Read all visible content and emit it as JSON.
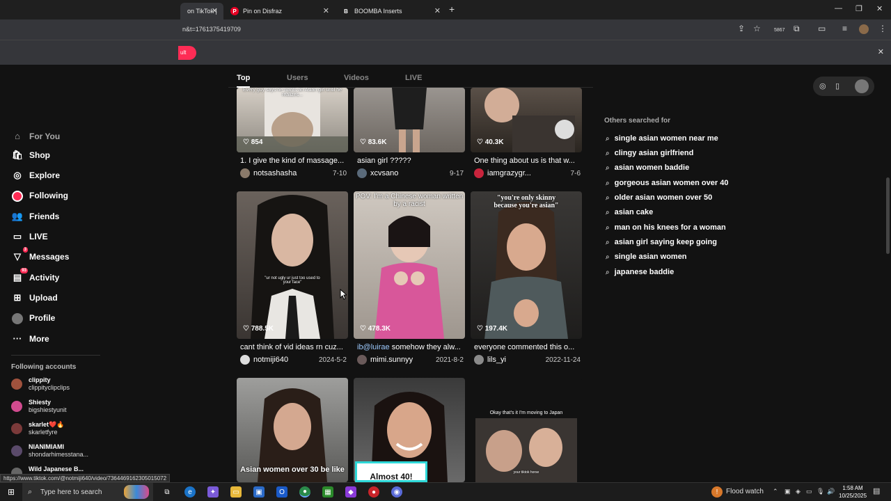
{
  "browser": {
    "tabs": [
      {
        "label": "on TikTok |"
      },
      {
        "label": "Pin on Disfraz"
      },
      {
        "label": "BOOMBA Inserts"
      }
    ],
    "url": "n&t=1761375419709",
    "ext_badge": "5867",
    "info_button": "ult"
  },
  "search_tabs": [
    "Top",
    "Users",
    "Videos",
    "LIVE"
  ],
  "sidebar": {
    "partial_top": "For You",
    "items": [
      {
        "label": "Shop"
      },
      {
        "label": "Explore"
      },
      {
        "label": "Following"
      },
      {
        "label": "Friends"
      },
      {
        "label": "LIVE"
      },
      {
        "label": "Messages",
        "badge": "3"
      },
      {
        "label": "Activity",
        "badge": "93"
      },
      {
        "label": "Upload"
      },
      {
        "label": "Profile"
      },
      {
        "label": "More"
      }
    ],
    "following_header": "Following accounts",
    "accounts": [
      {
        "name": "clippity",
        "handle": "clippityclipclips"
      },
      {
        "name": "Shiesty",
        "handle": "bigshiestyunit"
      },
      {
        "name": "skarlet❤️🔥",
        "handle": "skarletfyre"
      },
      {
        "name": "NIANIMIAMI",
        "handle": "shondarhimesstana..."
      },
      {
        "name": "Wild Japanese B...",
        "handle": ""
      }
    ]
  },
  "videos": [
    {
      "likes": "854",
      "caption": "1. I give the kind of massage...",
      "user": "notsashasha",
      "date": "7-10",
      "overlay": "Every guy says he wants an Asian girl until he realizes..."
    },
    {
      "likes": "83.6K",
      "caption": "asian girl ?????",
      "user": "xcvsano",
      "date": "9-17",
      "overlay": ""
    },
    {
      "likes": "40.3K",
      "caption": "One thing about us is that w...",
      "user": "iamgrazygr...",
      "date": "7-6",
      "overlay": ""
    },
    {
      "likes": "788.5K",
      "caption": "cant think of vid ideas rn cuz...",
      "user": "notmiji640",
      "date": "2024-5-2",
      "overlay": "\"ur not ugly ur just too used to your face\""
    },
    {
      "likes": "478.3K",
      "caption_mention": "ib@luirae",
      "caption": " somehow they alw...",
      "user": "mimi.sunnyy",
      "date": "2021-8-2",
      "overlay": "POV: I'm a Chinese woman written by a racist"
    },
    {
      "likes": "197.4K",
      "caption": "everyone commented this o...",
      "user": "lils_yi",
      "date": "2022-11-24",
      "overlay": "\"you're only skinny because you're asian\""
    },
    {
      "overlay": "Asian women over 30 be like"
    },
    {
      "overlay": "Almost 40!"
    },
    {
      "overlay": "Okay that's it I'm moving to Japan",
      "overlay2": "your tiktok horse"
    }
  ],
  "others": {
    "title": "Others searched for",
    "items": [
      "single asian women near me",
      "clingy asian girlfriend",
      "asian women baddie",
      "gorgeous asian women over 40",
      "older asian women over 50",
      "asian cake",
      "man on his knees for a woman",
      "asian girl saying keep going",
      "single asian women",
      "japanese baddie"
    ]
  },
  "status_url": "https://www.tiktok.com/@notmiji640/video/7364469162305015072",
  "taskbar": {
    "search_placeholder": "Type here to search",
    "weather": "Flood watch",
    "time": "1:58 AM",
    "date": "10/25/2025"
  },
  "colors": {
    "accent": "#fe2c55",
    "page_bg": "#121212"
  }
}
